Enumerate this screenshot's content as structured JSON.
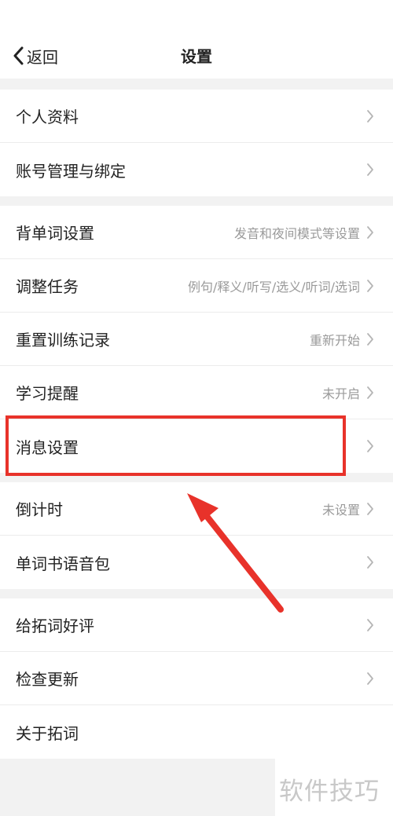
{
  "header": {
    "back_label": "返回",
    "title": "设置"
  },
  "groups": [
    {
      "items": [
        {
          "label": "个人资料",
          "value": ""
        },
        {
          "label": "账号管理与绑定",
          "value": ""
        }
      ]
    },
    {
      "items": [
        {
          "label": "背单词设置",
          "value": "发音和夜间模式等设置"
        },
        {
          "label": "调整任务",
          "value": "例句/释义/听写/选义/听词/选词"
        },
        {
          "label": "重置训练记录",
          "value": "重新开始"
        },
        {
          "label": "学习提醒",
          "value": "未开启"
        },
        {
          "label": "消息设置",
          "value": ""
        }
      ]
    },
    {
      "items": [
        {
          "label": "倒计时",
          "value": "未设置"
        },
        {
          "label": "单词书语音包",
          "value": ""
        }
      ]
    },
    {
      "items": [
        {
          "label": "给拓词好评",
          "value": ""
        },
        {
          "label": "检查更新",
          "value": ""
        },
        {
          "label": "关于拓词",
          "value": ""
        }
      ]
    }
  ],
  "annotation": {
    "color": "#e8322a"
  },
  "watermark": "软件技巧",
  "icons": {
    "back": "chevron-left-icon",
    "row": "chevron-right-icon"
  }
}
